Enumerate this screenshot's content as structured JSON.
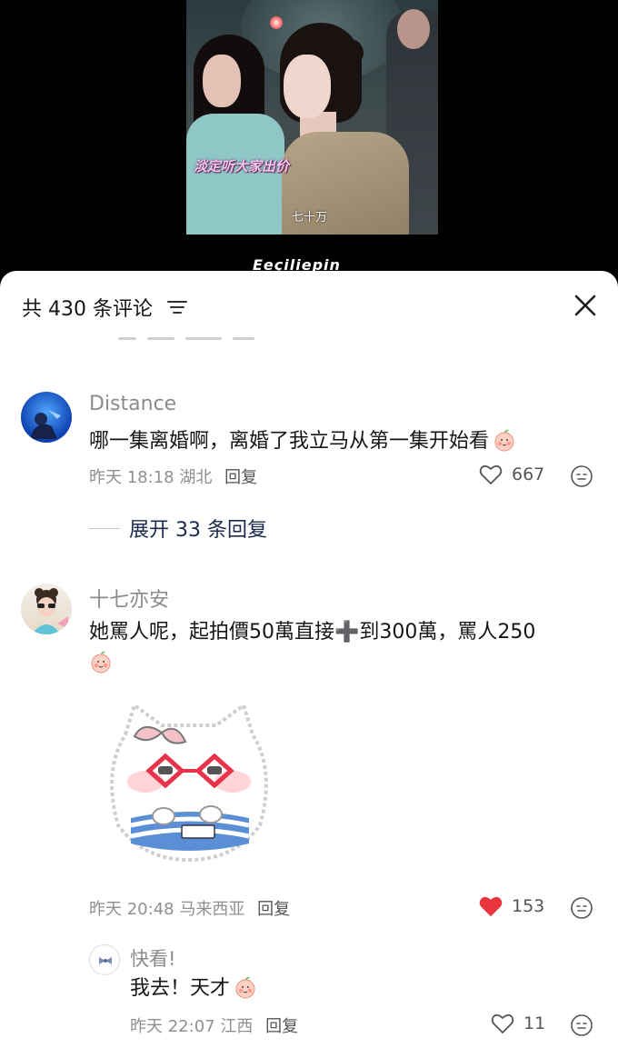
{
  "video": {
    "subtitle_top": "淡定听大家出价",
    "subtitle_bottom": "七十万",
    "watermark": "Eeçiliepin"
  },
  "sheet": {
    "title": "共 430 条评论",
    "filter_icon": "filter-lines-icon",
    "close_icon": "close-x-icon"
  },
  "comments": [
    {
      "username": "Distance",
      "text": "哪一集离婚啊，离婚了我立马从第一集开始看",
      "emoji": "peach-blush-emoji",
      "time": "昨天 18:18",
      "location": "湖北",
      "reply_label": "回复",
      "likes": "667",
      "liked": false,
      "expand_label": "展开 33 条回复"
    },
    {
      "username": "十七亦安",
      "text": "她罵人呢，起拍價50萬直接➕到300萬，罵人250",
      "emoji": "peach-blush-emoji",
      "sticker": "cat-with-glasses-sticker",
      "time": "昨天 20:48",
      "location": "马来西亚",
      "reply_label": "回复",
      "likes": "153",
      "liked": true
    }
  ],
  "replies": [
    {
      "username": "快看!",
      "text": "我去！天才",
      "emoji": "peach-blush-emoji",
      "time": "昨天 22:07",
      "location": "江西",
      "reply_label": "回复",
      "likes": "11",
      "liked": false
    }
  ],
  "colors": {
    "like_active": "#e8343d",
    "text_primary": "#161616",
    "text_secondary": "#8f8f8f",
    "expand_text": "#1c2a4d"
  }
}
